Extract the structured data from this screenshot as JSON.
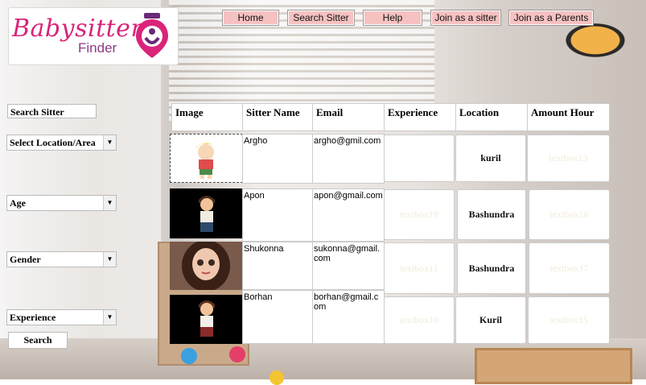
{
  "logo": {
    "title": "Babysitter",
    "subtitle": "Finder"
  },
  "nav": [
    "Home",
    "Search Sitter",
    "Help",
    "Join as a sitter",
    "Join as a Parents"
  ],
  "sidebar": {
    "heading": "Search Sitter",
    "location": "Select Location/Area",
    "age": "Age",
    "gender": "Gender",
    "experience": "Experience",
    "search_button": "Search"
  },
  "table": {
    "headers": [
      "Image",
      "Sitter Name",
      "Email",
      "Experience",
      "Location",
      "Amount Hour"
    ],
    "rows": [
      {
        "name": "Argho",
        "email": "argho@gmil.com",
        "experience": "",
        "location": "kuril",
        "amount": "textbox13"
      },
      {
        "name": "Apon",
        "email": "apon@gmail.com",
        "experience": "textbox19",
        "location": "Bashundra",
        "amount": "textbox18"
      },
      {
        "name": "Shukonna",
        "email": "sukonna@gmail.com",
        "experience": "textbox11",
        "location": "Bashundra",
        "amount": "textbox17"
      },
      {
        "name": "Borhan",
        "email": "borhan@gmail.com",
        "experience": "textbox10",
        "location": "Kuril",
        "amount": "textbox15"
      }
    ]
  },
  "colors": {
    "brand_pink": "#d9247a",
    "brand_purple": "#8e3a8a",
    "nav_bg": "#f6c1c1"
  },
  "icons": [
    "babysitter-logo-icon",
    "dropdown-arrow-icon"
  ]
}
